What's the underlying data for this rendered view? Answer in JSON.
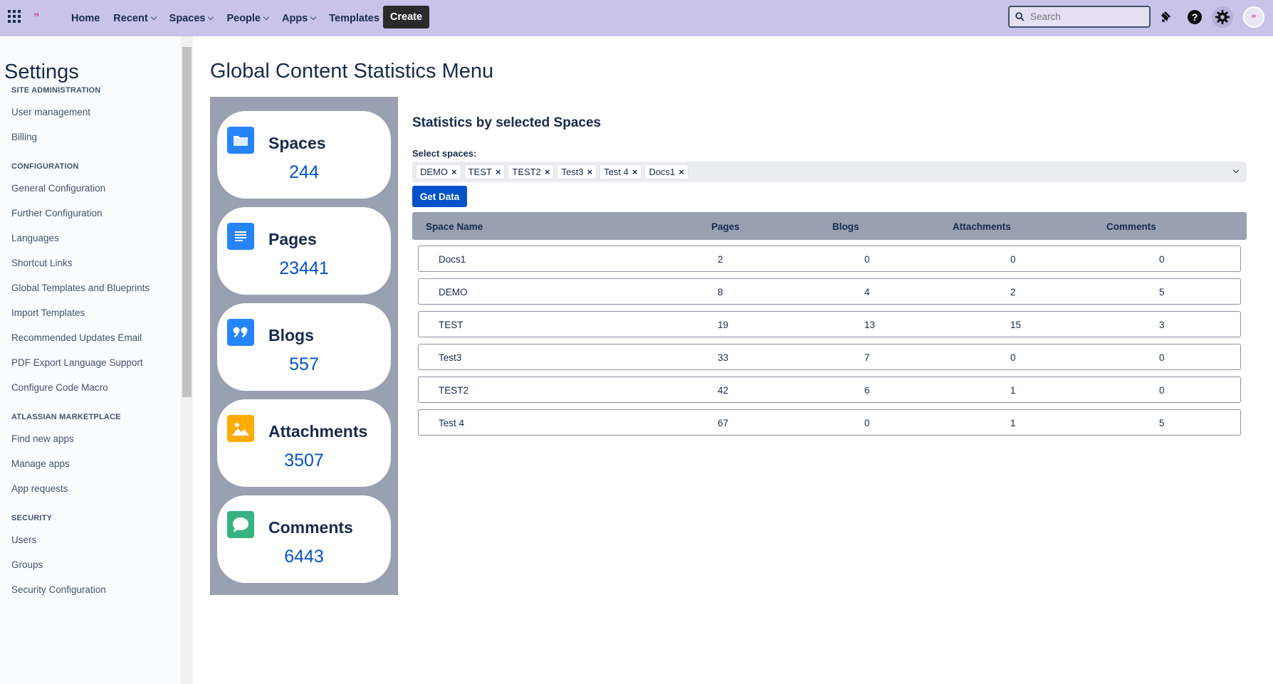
{
  "topbar": {
    "logo_text": "HI",
    "nav": [
      {
        "label": "Home",
        "dropdown": false
      },
      {
        "label": "Recent",
        "dropdown": true
      },
      {
        "label": "Spaces",
        "dropdown": true
      },
      {
        "label": "People",
        "dropdown": true
      },
      {
        "label": "Apps",
        "dropdown": true
      },
      {
        "label": "Templates",
        "dropdown": false
      }
    ],
    "create_label": "Create",
    "search_placeholder": "Search",
    "help_glyph": "?",
    "avatar_text": "HI"
  },
  "sidebar": {
    "title": "Settings",
    "sections": [
      {
        "heading": "SITE ADMINISTRATION",
        "items": [
          "User management",
          "Billing"
        ]
      },
      {
        "heading": "CONFIGURATION",
        "items": [
          "General Configuration",
          "Further Configuration",
          "Languages",
          "Shortcut Links",
          "Global Templates and Blueprints",
          "Import Templates",
          "Recommended Updates Email",
          "PDF Export Language Support",
          "Configure Code Macro"
        ]
      },
      {
        "heading": "ATLASSIAN MARKETPLACE",
        "items": [
          "Find new apps",
          "Manage apps",
          "App requests"
        ]
      },
      {
        "heading": "SECURITY",
        "items": [
          "Users",
          "Groups",
          "Security Configuration"
        ]
      }
    ]
  },
  "main": {
    "title": "Global Content Statistics Menu",
    "stats": [
      {
        "label": "Spaces",
        "value": "244",
        "icon": "folder-icon",
        "color": "#2684ff"
      },
      {
        "label": "Pages",
        "value": "23441",
        "icon": "page-lines-icon",
        "color": "#2684ff"
      },
      {
        "label": "Blogs",
        "value": "557",
        "icon": "quote-icon",
        "color": "#2684ff"
      },
      {
        "label": "Attachments",
        "value": "3507",
        "icon": "image-icon",
        "color": "#ffab00"
      },
      {
        "label": "Comments",
        "value": "6443",
        "icon": "speech-bubble-icon",
        "color": "#36b37e"
      }
    ],
    "section_title": "Statistics by selected Spaces",
    "select_label": "Select spaces:",
    "selected_spaces": [
      "DEMO",
      "TEST",
      "TEST2",
      "Test3",
      "Test 4",
      "Docs1"
    ],
    "tag_remove_glyph": "×",
    "get_data_label": "Get Data",
    "table": {
      "columns": [
        "Space Name",
        "Pages",
        "Blogs",
        "Attachments",
        "Comments"
      ],
      "rows": [
        [
          "Docs1",
          "2",
          "0",
          "0",
          "0"
        ],
        [
          "DEMO",
          "8",
          "4",
          "2",
          "5"
        ],
        [
          "TEST",
          "19",
          "13",
          "15",
          "3"
        ],
        [
          "Test3",
          "33",
          "7",
          "0",
          "0"
        ],
        [
          "TEST2",
          "42",
          "6",
          "1",
          "0"
        ],
        [
          "Test 4",
          "67",
          "0",
          "1",
          "5"
        ]
      ]
    }
  },
  "colors": {
    "topbar": "#c9c2e9",
    "panel": "#98a0b1",
    "primary": "#0052cc"
  }
}
